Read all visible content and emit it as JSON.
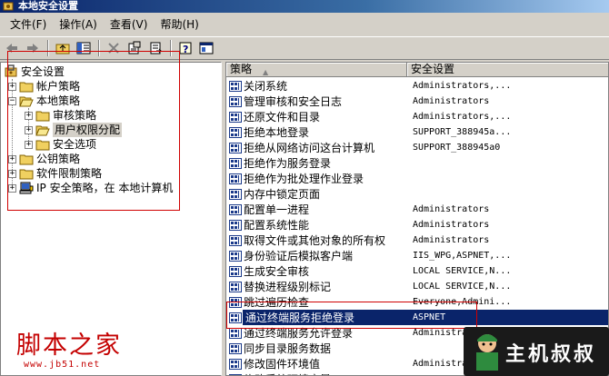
{
  "window": {
    "title": "本地安全设置"
  },
  "menu": [
    "文件(F)",
    "操作(A)",
    "查看(V)",
    "帮助(H)"
  ],
  "toolbar": [
    "back-icon",
    "forward-icon",
    "up-folder-icon",
    "show-tree-icon",
    "delete-icon",
    "properties-icon",
    "export-list-icon",
    "help-icon",
    "console-icon"
  ],
  "tree": {
    "root": "安全设置",
    "account_policy": "帐户策略",
    "local_policy": "本地策略",
    "audit_policy": "审核策略",
    "user_rights": "用户权限分配",
    "security_options": "安全选项",
    "public_key": "公钥策略",
    "software_restriction": "软件限制策略",
    "ip_security": "IP 安全策略，在 本地计算机"
  },
  "list": {
    "columns": {
      "policy": "策略",
      "setting": "安全设置"
    },
    "rows": [
      {
        "policy": "关闭系统",
        "setting": "Administrators,..."
      },
      {
        "policy": "管理审核和安全日志",
        "setting": "Administrators"
      },
      {
        "policy": "还原文件和目录",
        "setting": "Administrators,..."
      },
      {
        "policy": "拒绝本地登录",
        "setting": "SUPPORT_388945a..."
      },
      {
        "policy": "拒绝从网络访问这台计算机",
        "setting": "SUPPORT_388945a0"
      },
      {
        "policy": "拒绝作为服务登录",
        "setting": ""
      },
      {
        "policy": "拒绝作为批处理作业登录",
        "setting": ""
      },
      {
        "policy": "内存中锁定页面",
        "setting": ""
      },
      {
        "policy": "配置单一进程",
        "setting": "Administrators"
      },
      {
        "policy": "配置系统性能",
        "setting": "Administrators"
      },
      {
        "policy": "取得文件或其他对象的所有权",
        "setting": "Administrators"
      },
      {
        "policy": "身份验证后模拟客户端",
        "setting": "IIS_WPG,ASPNET,..."
      },
      {
        "policy": "生成安全审核",
        "setting": "LOCAL SERVICE,N..."
      },
      {
        "policy": "替换进程级别标记",
        "setting": "LOCAL SERVICE,N..."
      },
      {
        "policy": "跳过遍历检查",
        "setting": "Everyone,Admini..."
      },
      {
        "policy": "通过终端服务拒绝登录",
        "setting": "ASPNET"
      },
      {
        "policy": "通过终端服务允许登录",
        "setting": "Administrators,..."
      },
      {
        "policy": "同步目录服务数据",
        "setting": ""
      },
      {
        "policy": "修改固件环境值",
        "setting": "Administrators"
      },
      {
        "policy": "修改系统环境变量",
        "setting": ""
      }
    ],
    "selected_index": 15
  },
  "watermark": {
    "left_text": "脚本之家",
    "left_url": "www.jb51.net",
    "right_text": "主机叔叔"
  },
  "colors": {
    "selection": "#0a246a",
    "annotation": "#d00000",
    "window_face": "#d4d0c8"
  }
}
